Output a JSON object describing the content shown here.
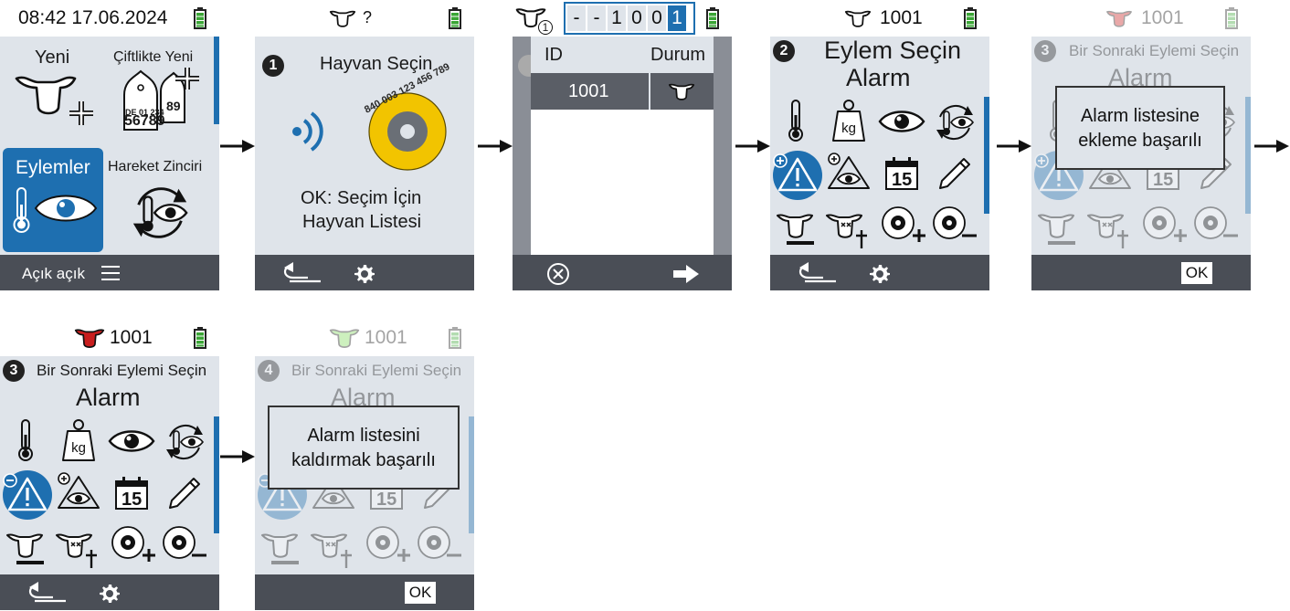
{
  "screen1": {
    "clock": "08:42 17.06.2024",
    "tiles": [
      {
        "label": "Yeni",
        "icon": "cow-add-icon"
      },
      {
        "label": "Çiftlikte Yeni",
        "icon": "ear-tag-add-icon",
        "tag_line1": "DE 01 234",
        "tag_line2": "56789",
        "tag_line3": "89"
      },
      {
        "label": "Eylemler",
        "icon": "thermometer-eye-icon"
      },
      {
        "label": "Hareket Zinciri",
        "icon": "cycle-eye-icon"
      }
    ],
    "footer_label": "Açık açık",
    "footer_icon": "menu-icon"
  },
  "screen2": {
    "status_text": "?",
    "step": "1",
    "title": "Hayvan Seçin",
    "tag_digits": "840 003 123 456 789",
    "hint_line1": "OK: Seçim İçin",
    "hint_line2": "Hayvan Listesi"
  },
  "screen3": {
    "cow_badge": "1",
    "id_digits": [
      "-",
      "-",
      "1",
      "0",
      "0",
      "1"
    ],
    "col_id": "ID",
    "col_status": "Durum",
    "row_id": "1001"
  },
  "screen4": {
    "status_text": "1001",
    "step": "2",
    "title_line1": "Eylem Seçin",
    "title_line2": "Alarm",
    "calendar_day": "15",
    "weight_label": "kg"
  },
  "screen5": {
    "status_text": "1001",
    "step": "3",
    "title_line1": "Bir Sonraki Eylemi Seçin",
    "title_line2": "Alarm",
    "dialog_line1": "Alarm listesine",
    "dialog_line2": "ekleme başarılı",
    "ok_label": "OK"
  },
  "screen6": {
    "status_text": "1001",
    "step": "3",
    "title_line1": "Bir Sonraki Eylemi Seçin",
    "title_line2": "Alarm"
  },
  "screen7": {
    "status_text": "1001",
    "step": "4",
    "title_line1": "Bir Sonraki Eylemi Seçin",
    "title_line2": "Alarm",
    "dialog_line1": "Alarm listesini",
    "dialog_line2": "kaldırmak başarılı",
    "ok_label": "OK"
  },
  "colors": {
    "accent_blue": "#1e6fb0",
    "footer_gray": "#4a4e56",
    "panel_gray": "#dfe4ea",
    "battery_green": "#3aa535",
    "tag_yellow": "#f2c400",
    "alarm_red": "#c81e1e",
    "alarm_green": "#7ed957"
  }
}
